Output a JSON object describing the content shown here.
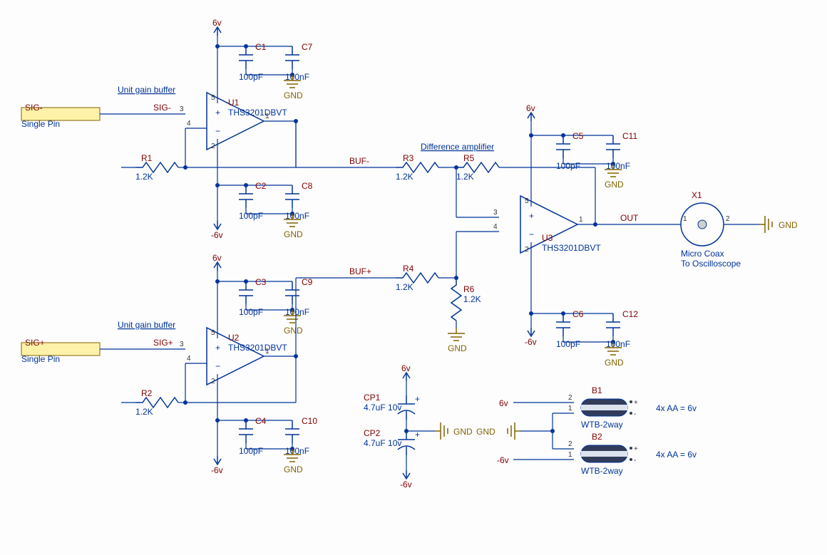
{
  "titles": {
    "buf1": "Unit gain buffer",
    "buf2": "Unit gain buffer",
    "diff": "Difference amplifier"
  },
  "ports": {
    "sigminus": "Single Pin",
    "sigplus": "Single Pin"
  },
  "nets": {
    "SIGm_port": "SIG-",
    "SIGm": "SIG-",
    "SIGp_port": "SIG+",
    "SIGp": "SIG+",
    "BUFm": "BUF-",
    "BUFp": "BUF+",
    "OUT": "OUT",
    "p6v_1": "6v",
    "m6v_1": "-6v",
    "p6v_2": "6v",
    "m6v_2": "-6v",
    "p6v_3": "6v",
    "m6v_3": "-6v",
    "p6v_cp": "6v",
    "m6v_cp": "-6v",
    "p6v_b": "6v",
    "m6v_b": "-6v",
    "GND_1": "GND",
    "GND_2": "GND",
    "GND_3": "GND",
    "GND_4": "GND",
    "GND_5": "GND",
    "GND_6": "GND",
    "GND_r6": "GND",
    "GND_cp": "GND",
    "GND_batt": "GND",
    "GND_out": "GND"
  },
  "U1": {
    "name": "U1",
    "type": "THS3201DBVT"
  },
  "U2": {
    "name": "U2",
    "type": "THS3201DBVT"
  },
  "U3": {
    "name": "U3",
    "type": "THS3201DBVT"
  },
  "R1": {
    "name": "R1",
    "val": "1.2K"
  },
  "R2": {
    "name": "R2",
    "val": "1.2K"
  },
  "R3": {
    "name": "R3",
    "val": "1.2K"
  },
  "R4": {
    "name": "R4",
    "val": "1.2K"
  },
  "R5": {
    "name": "R5",
    "val": "1.2K"
  },
  "R6": {
    "name": "R6",
    "val": "1.2K"
  },
  "C1": {
    "name": "C1",
    "val": "100pF"
  },
  "C2": {
    "name": "C2",
    "val": "100pF"
  },
  "C3": {
    "name": "C3",
    "val": "100pF"
  },
  "C4": {
    "name": "C4",
    "val": "100pF"
  },
  "C5": {
    "name": "C5",
    "val": "100pF"
  },
  "C6": {
    "name": "C6",
    "val": "100pF"
  },
  "C7": {
    "name": "C7",
    "val": "100nF"
  },
  "C8": {
    "name": "C8",
    "val": "100nF"
  },
  "C9": {
    "name": "C9",
    "val": "100nF"
  },
  "C10": {
    "name": "C10",
    "val": "100nF"
  },
  "C11": {
    "name": "C11",
    "val": "100nF"
  },
  "C12": {
    "name": "C12",
    "val": "100nF"
  },
  "CP1": {
    "name": "CP1",
    "val": "4.7uF 10v"
  },
  "CP2": {
    "name": "CP2",
    "val": "4.7uF 10v"
  },
  "B1": {
    "name": "B1",
    "val": "WTB-2way",
    "note": "4x AA = 6v"
  },
  "B2": {
    "name": "B2",
    "val": "WTB-2way",
    "note": "4x AA = 6v"
  },
  "X1": {
    "name": "X1",
    "val": "Micro Coax",
    "val2": "To Oscilloscope"
  },
  "pins": {
    "p1": "1",
    "p2": "2",
    "p3": "3",
    "p4": "4",
    "p5": "5",
    "u2p1": "1",
    "u2p2": "2",
    "u2p3": "3",
    "u2p4": "4",
    "u2p5": "5",
    "u3p1": "1",
    "u3p2": "2",
    "u3p3": "3",
    "u3p4": "4",
    "u3p5": "5",
    "x1p1": "1",
    "x1p2": "2",
    "b1p1": "1",
    "b1p2": "2",
    "b2p1": "1",
    "b2p2": "2"
  },
  "signs": {
    "plus": "+",
    "minus": "−",
    "cpplus1": "+",
    "cpplus2": "+"
  }
}
